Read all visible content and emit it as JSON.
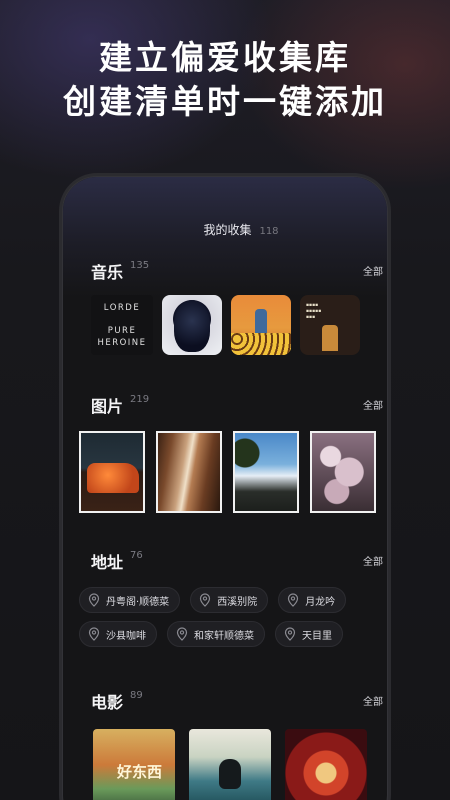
{
  "headline": {
    "line1": "建立偏爱收集库",
    "line2": "创建清单时一键添加"
  },
  "header": {
    "title": "我的收集",
    "count": "118"
  },
  "sections": {
    "music": {
      "title": "音乐",
      "count": "135",
      "all_label": "全部",
      "albums": [
        {
          "icon": "album-cover-lorde",
          "lines": [
            "LORDE",
            "PURE",
            "HEROINE"
          ]
        },
        {
          "icon": "album-cover-portrait"
        },
        {
          "icon": "album-cover-flowers"
        },
        {
          "icon": "album-cover-book"
        }
      ]
    },
    "pictures": {
      "title": "图片",
      "count": "219",
      "all_label": "全部",
      "photos": [
        "photo-car",
        "photo-wood",
        "photo-sky",
        "photo-blossom"
      ]
    },
    "places": {
      "title": "地址",
      "count": "76",
      "all_label": "全部",
      "row1": [
        "丹粤阁·顺德菜",
        "西溪别院",
        "月龙吟"
      ],
      "row2": [
        "沙县咖啡",
        "和家轩顺德菜",
        "天目里"
      ]
    },
    "movies": {
      "title": "电影",
      "count": "89",
      "all_label": "全部",
      "poster1_text": "好东西"
    }
  },
  "colors": {
    "background": "#17171a",
    "screen": "#151517",
    "chip": "#1f1f23"
  }
}
